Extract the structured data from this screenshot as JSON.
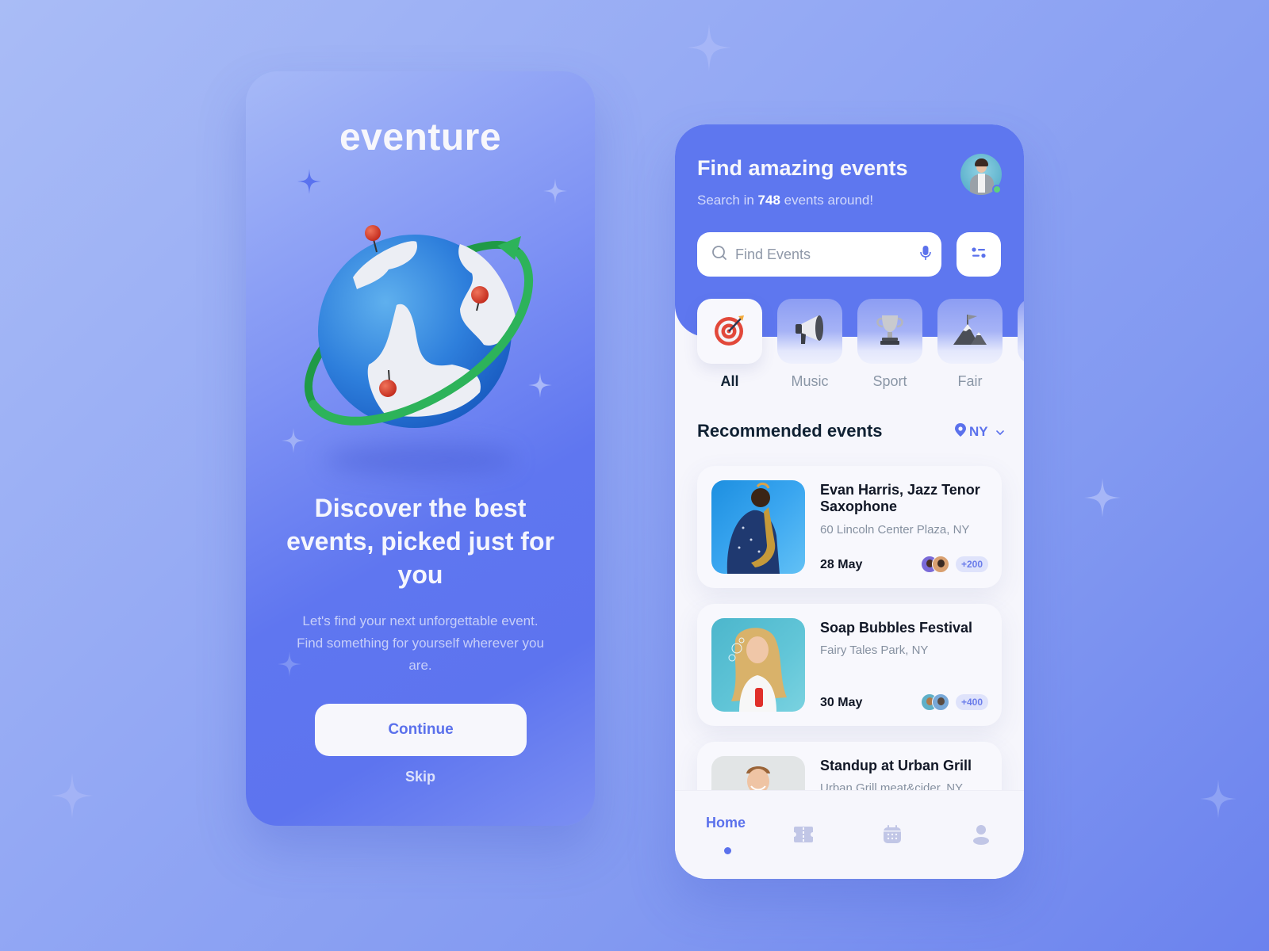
{
  "onboarding": {
    "brand": "eventure",
    "illustration": "globe-with-pins-illustration",
    "title": "Discover the best events, picked just for you",
    "description": "Let's find your next unforgettable event. Find something for yourself wherever you are.",
    "continue_label": "Continue",
    "skip_label": "Skip"
  },
  "home": {
    "header": {
      "title": "Find amazing events",
      "subtitle_prefix": "Search in ",
      "event_count": "748",
      "subtitle_suffix": " events around!",
      "avatar_status": "online"
    },
    "search": {
      "placeholder": "Find Events",
      "value": "",
      "search_icon": "search-icon",
      "mic_icon": "microphone-icon",
      "filter_icon": "filter-icon"
    },
    "categories": [
      {
        "label": "All",
        "icon": "target-dart-icon",
        "active": true
      },
      {
        "label": "Music",
        "icon": "megaphone-icon",
        "active": false
      },
      {
        "label": "Sport",
        "icon": "trophy-icon",
        "active": false
      },
      {
        "label": "Fair",
        "icon": "mountain-flag-icon",
        "active": false
      }
    ],
    "recommended": {
      "title": "Recommended events",
      "location": "NY"
    },
    "events": [
      {
        "title": "Evan Harris, Jazz Tenor Saxophone",
        "address": "60 Lincoln Center Plaza, NY",
        "date": "28 May",
        "attendees_more": "+200"
      },
      {
        "title": "Soap Bubbles Festival",
        "address": "Fairy Tales Park, NY",
        "date": "30 May",
        "attendees_more": "+400"
      },
      {
        "title": "Standup at Urban Grill",
        "address": "Urban Grill meat&cider, NY",
        "date": "",
        "attendees_more": ""
      }
    ],
    "nav": {
      "items": [
        {
          "label": "Home",
          "icon": "home",
          "active": true
        },
        {
          "label": "",
          "icon": "ticket-icon",
          "active": false
        },
        {
          "label": "",
          "icon": "calendar-icon",
          "active": false
        },
        {
          "label": "",
          "icon": "profile-icon",
          "active": false
        }
      ]
    }
  },
  "colors": {
    "accent": "#5b71ec",
    "header_blue": "#5e77ef",
    "surface": "#f6f6fc",
    "text_dark": "#102133",
    "text_muted": "#8a96a6",
    "online": "#5dd17e"
  }
}
